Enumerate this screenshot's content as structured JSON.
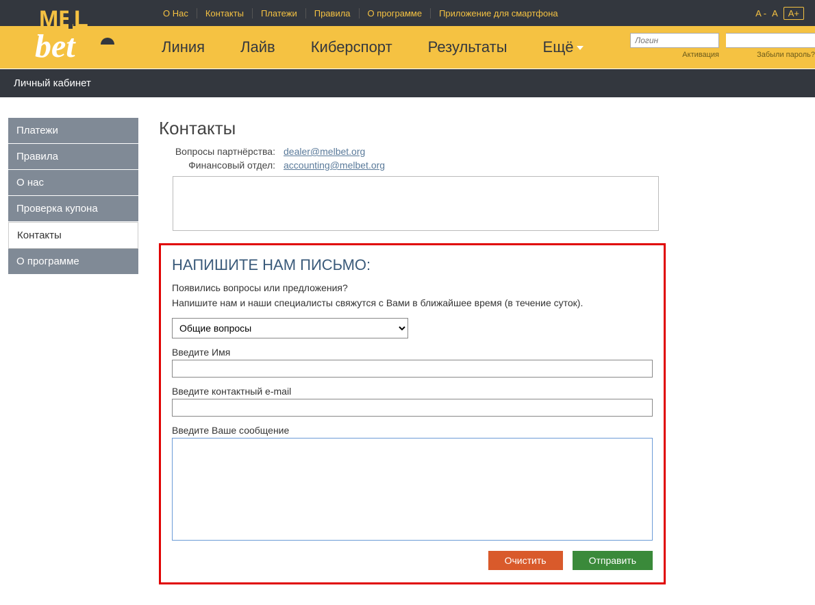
{
  "topnav": {
    "items": [
      "О Нас",
      "Контакты",
      "Платежи",
      "Правила",
      "О программе",
      "Приложение для смартфона"
    ]
  },
  "fontctl": {
    "minus": "A -",
    "normal": "A",
    "plus": "A+"
  },
  "mainnav": {
    "items": [
      "Линия",
      "Лайв",
      "Киберспорт",
      "Результаты",
      "Ещё"
    ]
  },
  "login": {
    "login_placeholder": "Логин",
    "activation": "Активация",
    "forgot": "Забыли пароль?"
  },
  "cabinet_title": "Личный кабинет",
  "sidebar": {
    "items": [
      "Платежи",
      "Правила",
      "О нас",
      "Проверка купона",
      "Контакты",
      "О программе"
    ],
    "active_index": 4
  },
  "page": {
    "title": "Контакты",
    "partner_label": "Вопросы партнёрства:",
    "partner_email": "dealer@melbet.org",
    "finance_label": "Финансовый отдел:",
    "finance_email": "accounting@melbet.org"
  },
  "form": {
    "heading": "НАПИШИТЕ НАМ ПИСЬМО:",
    "line1": "Появились вопросы или предложения?",
    "line2": "Напишите нам и наши специалисты свяжутся с Вами в ближайшее время (в течение суток).",
    "select_value": "Общие вопросы",
    "name_label": "Введите Имя",
    "email_label": "Введите контактный e-mail",
    "message_label": "Введите Ваше сообщение",
    "clear_btn": "Очистить",
    "send_btn": "Отправить"
  }
}
